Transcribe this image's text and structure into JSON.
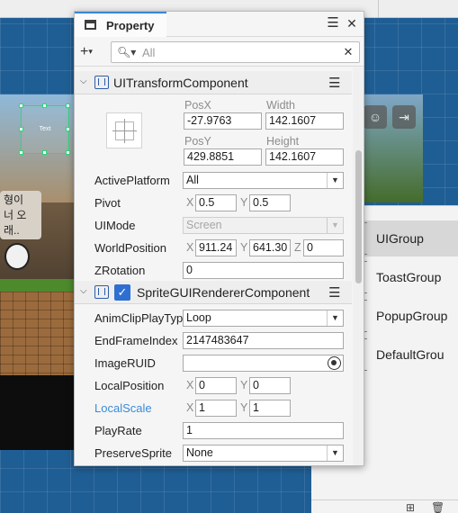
{
  "window": {
    "title": "Property"
  },
  "toolbar": {
    "add_label": "+",
    "add_arrow": "▾",
    "search_placeholder": "All",
    "search_icon": "search-icon",
    "clear_label": "✕"
  },
  "scene": {
    "text_widget_label": "Text",
    "speech_bubble": "형이\n너 오\n래..",
    "icons": [
      "person-icon",
      "exit-icon"
    ]
  },
  "groups": {
    "items": [
      {
        "label": "UIGroup",
        "selected": true
      },
      {
        "label": "ToastGroup",
        "selected": false
      },
      {
        "label": "PopupGroup",
        "selected": false
      },
      {
        "label": "DefaultGrou",
        "selected": false
      }
    ]
  },
  "ui_transform": {
    "name": "UITransformComponent",
    "posx_label": "PosX",
    "posx": "-27.9763",
    "width_label": "Width",
    "width": "142.1607",
    "posy_label": "PosY",
    "posy": "429.8851",
    "height_label": "Height",
    "height": "142.1607",
    "active_platform_label": "ActivePlatform",
    "active_platform": "All",
    "pivot_label": "Pivot",
    "pivot_x": "0.5",
    "pivot_y": "0.5",
    "uimode_label": "UIMode",
    "uimode": "Screen",
    "world_position_label": "WorldPosition",
    "world_x": "911.24",
    "world_y": "641.30",
    "world_z": "0",
    "zrotation_label": "ZRotation",
    "zrotation": "0"
  },
  "sprite_renderer": {
    "name": "SpriteGUIRendererComponent",
    "enabled": true,
    "check_mark": "✓",
    "anim_clip_label": "AnimClipPlayTyp",
    "anim_clip": "Loop",
    "end_frame_label": "EndFrameIndex",
    "end_frame": "2147483647",
    "image_ruid_label": "ImageRUID",
    "image_ruid": "",
    "local_position_label": "LocalPosition",
    "local_pos_x": "0",
    "local_pos_y": "0",
    "local_scale_label": "LocalScale",
    "local_scale_x": "1",
    "local_scale_y": "1",
    "play_rate_label": "PlayRate",
    "play_rate": "1",
    "preserve_sprite_label": "PreserveSprite",
    "preserve_sprite": "None"
  },
  "axes": {
    "x": "X",
    "y": "Y"
  },
  "glyphs": {
    "collapse": "⌄",
    "dropdown": "▼",
    "menu": "☰",
    "close": "✕"
  },
  "colors": {
    "accent": "#3a87d6",
    "link": "#3a8bd8",
    "checkbox": "#2f6fd1",
    "selection_green": "#2bd97a"
  }
}
